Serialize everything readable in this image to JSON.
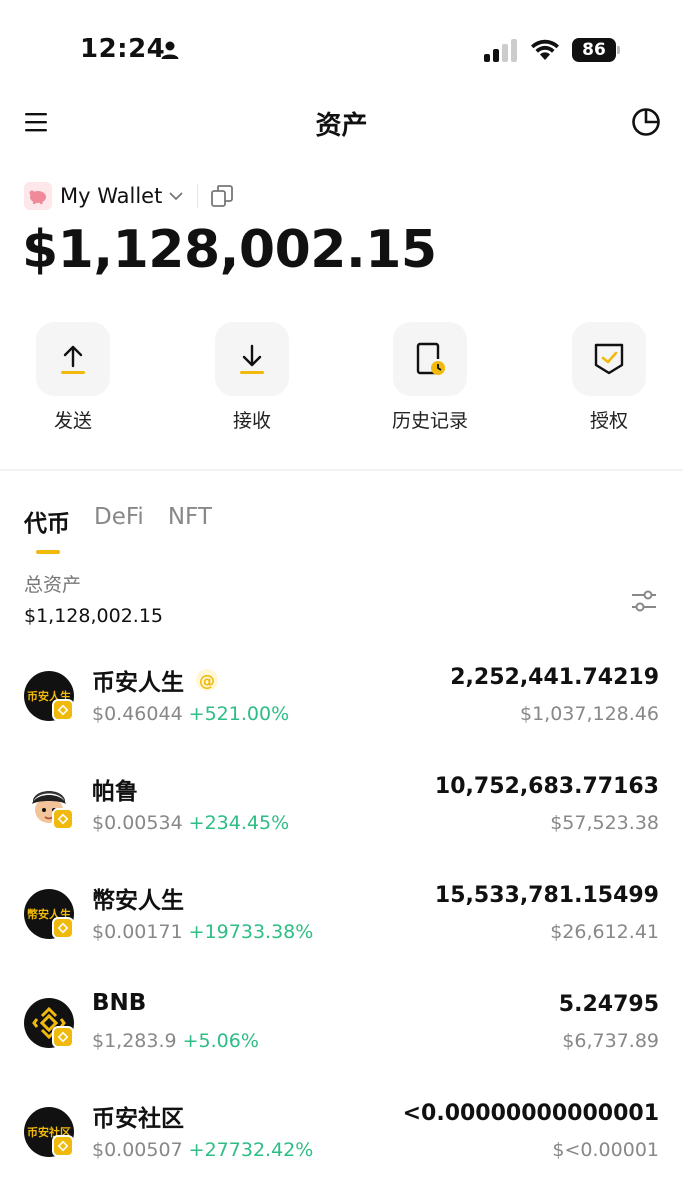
{
  "status_bar": {
    "time": "12:24",
    "battery": "86"
  },
  "header": {
    "title": "资产"
  },
  "wallet": {
    "name": "My Wallet",
    "total_balance": "$1,128,002.15"
  },
  "actions": [
    {
      "label": "发送",
      "icon": "send-icon"
    },
    {
      "label": "接收",
      "icon": "receive-icon"
    },
    {
      "label": "历史记录",
      "icon": "history-icon"
    },
    {
      "label": "授权",
      "icon": "authorize-icon"
    }
  ],
  "tabs": [
    {
      "label": "代币",
      "active": true
    },
    {
      "label": "DeFi",
      "active": false
    },
    {
      "label": "NFT",
      "active": false
    }
  ],
  "assets": {
    "total_label": "总资产",
    "total_value": "$1,128,002.15"
  },
  "tokens": [
    {
      "name": "币安人生",
      "logo_text": "币安人生",
      "price": "$0.46044",
      "change": "+521.00%",
      "amount": "2,252,441.74219",
      "value": "$1,037,128.46",
      "has_at_badge": true
    },
    {
      "name": "帕鲁",
      "logo_text": "",
      "price": "$0.00534",
      "change": "+234.45%",
      "amount": "10,752,683.77163",
      "value": "$57,523.38",
      "has_at_badge": false
    },
    {
      "name": "幣安人生",
      "logo_text": "幣安人生",
      "price": "$0.00171",
      "change": "+19733.38%",
      "amount": "15,533,781.15499",
      "value": "$26,612.41",
      "has_at_badge": false
    },
    {
      "name": "BNB",
      "logo_text": "",
      "price": "$1,283.9",
      "change": "+5.06%",
      "amount": "5.24795",
      "value": "$6,737.89",
      "has_at_badge": false
    },
    {
      "name": "币安社区",
      "logo_text": "币安社区",
      "price": "$0.00507",
      "change": "+27732.42%",
      "amount": "<0.00000000000001",
      "value": "$<0.00001",
      "has_at_badge": false
    }
  ],
  "colors": {
    "accent": "#f0b90b",
    "positive": "#2ebd85",
    "muted": "#888888"
  }
}
